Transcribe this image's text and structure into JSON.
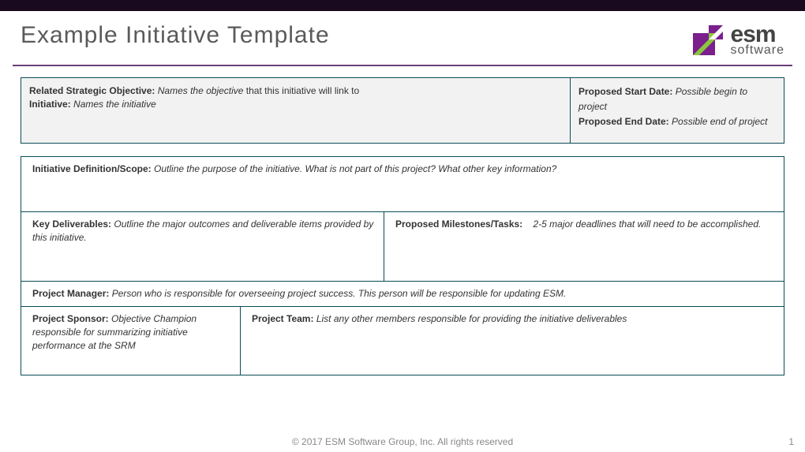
{
  "header": {
    "title": "Example Initiative Template",
    "logo": {
      "esm": "esm",
      "software": "software"
    }
  },
  "topbox": {
    "relatedLabel": "Related Strategic Objective:",
    "relatedItalic": "Names the objective",
    "relatedTail": " that this initiative will link to",
    "initiativeLabel": "Initiative:",
    "initiativeItalic": "Names the initiative",
    "startLabel": "Proposed Start Date:",
    "startItalic": "Possible begin to project",
    "endLabel": "Proposed End Date:",
    "endItalic": "Possible end of project"
  },
  "mainbox": {
    "scopeLabel": "Initiative Definition/Scope:",
    "scopeText": "Outline the purpose of the initiative.  What is not part of this project?  What other key information?",
    "delivLabel": "Key Deliverables:",
    "delivText": "Outline the major outcomes and deliverable items provided by this initiative.",
    "milestonesLabel": "Proposed Milestones/Tasks:",
    "milestonesText": "2-5 major deadlines that will need to be accomplished.",
    "pmLabel": "Project Manager:",
    "pmText": "Person who is responsible for overseeing project success.  This person will be responsible for updating ESM.",
    "sponsorLabel": "Project Sponsor:",
    "sponsorText": "Objective Champion responsible for summarizing initiative performance at the SRM",
    "teamLabel": "Project Team:",
    "teamText": "List any other members responsible for providing the initiative deliverables"
  },
  "footer": {
    "copyright": "© 2017 ESM Software Group, Inc. All rights reserved",
    "page": "1"
  }
}
